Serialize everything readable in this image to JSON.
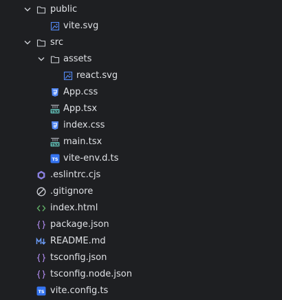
{
  "tree": {
    "items": [
      {
        "label": "public",
        "icon": "folder-icon",
        "expanded": true
      },
      {
        "label": "vite.svg",
        "icon": "svg-image-icon"
      },
      {
        "label": "src",
        "icon": "folder-icon",
        "expanded": true
      },
      {
        "label": "assets",
        "icon": "folder-icon",
        "expanded": true
      },
      {
        "label": "react.svg",
        "icon": "svg-image-icon"
      },
      {
        "label": "App.css",
        "icon": "css-file-icon"
      },
      {
        "label": "App.tsx",
        "icon": "tsx-file-icon"
      },
      {
        "label": "index.css",
        "icon": "css-file-icon"
      },
      {
        "label": "main.tsx",
        "icon": "tsx-file-icon"
      },
      {
        "label": "vite-env.d.ts",
        "icon": "ts-file-icon"
      },
      {
        "label": ".eslintrc.cjs",
        "icon": "eslint-icon"
      },
      {
        "label": ".gitignore",
        "icon": "ignore-icon"
      },
      {
        "label": "index.html",
        "icon": "html-file-icon"
      },
      {
        "label": "package.json",
        "icon": "json-file-icon"
      },
      {
        "label": "README.md",
        "icon": "markdown-icon"
      },
      {
        "label": "tsconfig.json",
        "icon": "json-file-icon"
      },
      {
        "label": "tsconfig.node.json",
        "icon": "json-file-icon"
      },
      {
        "label": "vite.config.ts",
        "icon": "ts-file-icon"
      }
    ]
  },
  "colors": {
    "background": "#1e1f22",
    "text": "#dfe1e5",
    "folder": "#ced0d6",
    "css": "#548af7",
    "tsx_badge": "#5fb8b0",
    "ts_badge": "#3574f0",
    "svg_image": "#548af7",
    "eslint": "#8a80e0",
    "html": "#5fad65",
    "json": "#b18cf0",
    "markdown": "#6b9bf5"
  }
}
